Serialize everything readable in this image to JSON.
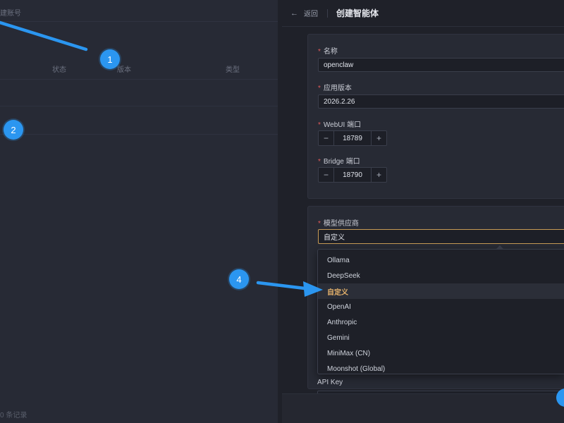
{
  "background": {
    "top_label": "建账号",
    "columns": [
      "状态",
      "版本",
      "类型"
    ],
    "footer": "0 条记录"
  },
  "drawer": {
    "back_label": "返回",
    "title": "创建智能体",
    "basic": {
      "name_label": "名称",
      "name_value": "openclaw",
      "version_label": "应用版本",
      "version_value": "2026.2.26",
      "webui_label": "WebUI 端口",
      "webui_value": "18789",
      "bridge_label": "Bridge 端口",
      "bridge_value": "18790",
      "minus": "−",
      "plus": "+"
    },
    "model": {
      "provider_label": "模型供应商",
      "provider_value": "自定义",
      "options": [
        "Ollama",
        "DeepSeek",
        "自定义",
        "OpenAI",
        "Anthropic",
        "Gemini",
        "MiniMax (CN)",
        "Moonshot (Global)"
      ],
      "selected_index": 2,
      "api_key_label": "API Key"
    }
  },
  "annotations": {
    "badge_1": "1",
    "badge_2": "2",
    "badge_4": "4"
  },
  "colors": {
    "accent": "#2b96f0",
    "selected": "#e8b46c",
    "required": "#e05a5a"
  }
}
